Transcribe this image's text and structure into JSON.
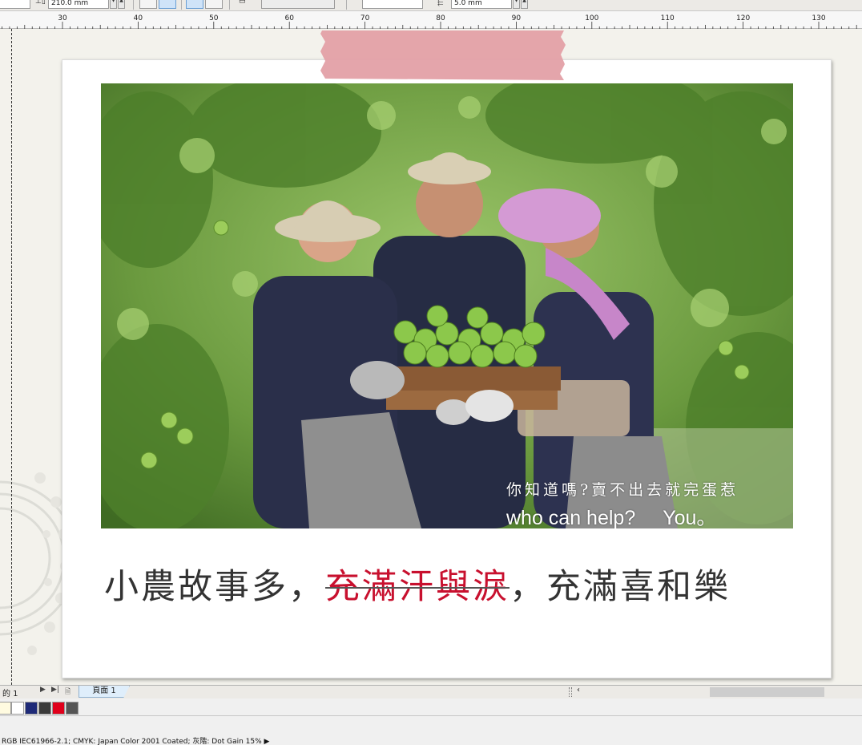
{
  "property_bar": {
    "height_value": "210.0 mm",
    "nudge_value": "5.0 mm"
  },
  "ruler": {
    "unit_labels": [
      "30",
      "40",
      "50",
      "60",
      "70",
      "80",
      "90",
      "100",
      "110",
      "120",
      "130"
    ]
  },
  "card": {
    "photo_caption_line1": "你知道嗎?賣不出去就完蛋惹",
    "photo_caption_line2_a": "who can help?",
    "photo_caption_line2_b": "You。",
    "headline_part1": "小農故事多，",
    "headline_struck": "充滿汗與淚",
    "headline_part2": "，充滿喜和樂"
  },
  "page_nav": {
    "page_count_label": "的 1",
    "tab_label": "頁面 1"
  },
  "palette": {
    "colors": [
      "#fffbe0",
      "#ffffff",
      "#1e2a78",
      "#3a3a3a",
      "#e0001b",
      "#555555"
    ]
  },
  "status": {
    "color_profile_text": "RGB IEC61966-2.1; CMYK: Japan Color 2001 Coated; 灰階: Dot Gain 15%"
  }
}
